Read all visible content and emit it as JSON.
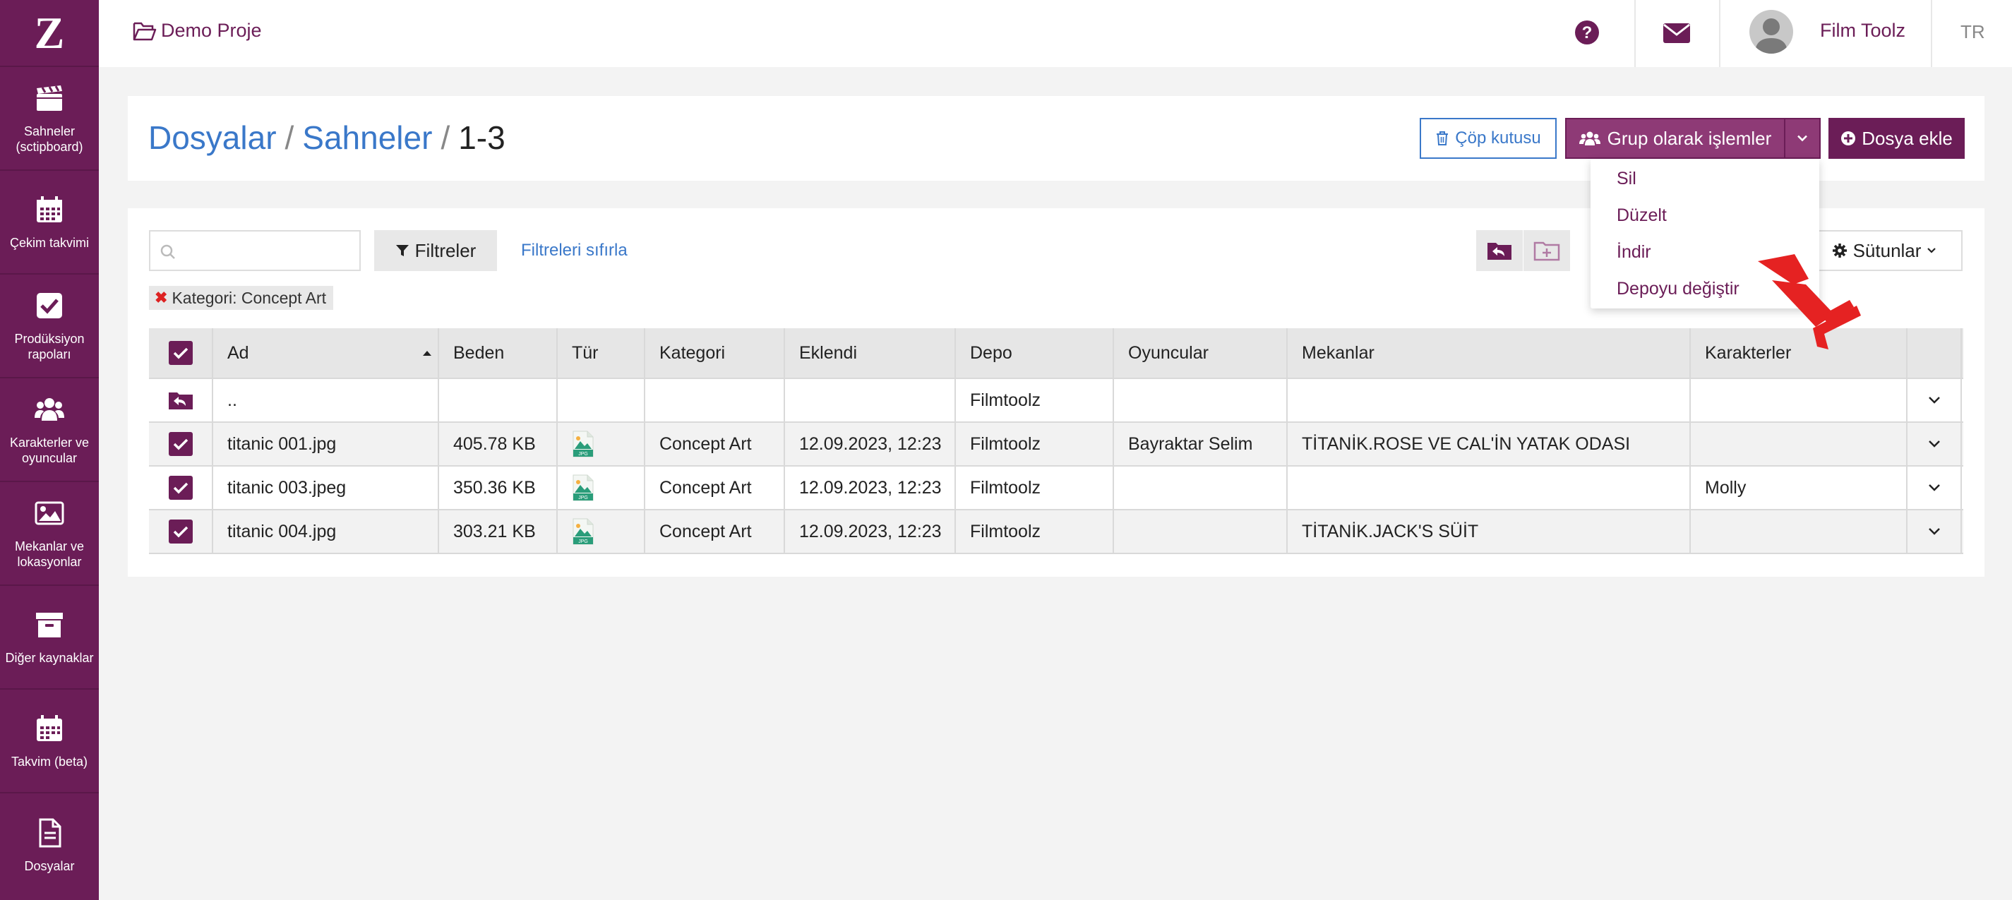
{
  "sidebar": {
    "logo": "Z",
    "items": [
      {
        "label": "Sahneler (sctipboard)",
        "icon": "clapperboard-icon"
      },
      {
        "label": "Çekim takvimi",
        "icon": "calendar-icon"
      },
      {
        "label": "Prodüksiyon rapoları",
        "icon": "check-square-icon"
      },
      {
        "label": "Karakterler ve oyuncular",
        "icon": "users-icon"
      },
      {
        "label": "Mekanlar ve lokasyonlar",
        "icon": "image-icon"
      },
      {
        "label": "Diğer kaynaklar",
        "icon": "archive-icon"
      },
      {
        "label": "Takvim (beta)",
        "icon": "calendar-icon"
      },
      {
        "label": "Dosyalar",
        "icon": "file-icon"
      }
    ]
  },
  "topbar": {
    "project": "Demo Proje",
    "username": "Film Toolz",
    "language": "TR"
  },
  "header": {
    "breadcrumb": [
      "Dosyalar",
      "Sahneler",
      "1-3"
    ],
    "trash_label": "Çöp kutusu",
    "group_label": "Grup olarak işlemler",
    "add_label": "Dosya ekle"
  },
  "group_menu": [
    "Sil",
    "Düzelt",
    "İndir",
    "Depoyu değiştir"
  ],
  "toolbar": {
    "search_placeholder": "",
    "filter_label": "Filtreler",
    "reset_label": "Filtreleri sıfırla",
    "columns_label": "Sütunlar"
  },
  "active_filter": {
    "key": "Kategori:",
    "value": "Concept Art"
  },
  "table": {
    "columns": [
      "Ad",
      "Beden",
      "Tür",
      "Kategori",
      "Eklendi",
      "Depo",
      "Oyuncular",
      "Mekanlar",
      "Karakterler"
    ],
    "parent_row": {
      "name": "..",
      "depo": "Filmtoolz"
    },
    "rows": [
      {
        "name": "titanic 001.jpg",
        "size": "405.78 KB",
        "type": "JPG",
        "category": "Concept Art",
        "added": "12.09.2023, 12:23",
        "depo": "Filmtoolz",
        "actors": "Bayraktar Selim",
        "locations": "TİTANİK.ROSE VE CAL'İN YATAK ODASI",
        "characters": "",
        "checked": true
      },
      {
        "name": "titanic 003.jpeg",
        "size": "350.36 KB",
        "type": "JPG",
        "category": "Concept Art",
        "added": "12.09.2023, 12:23",
        "depo": "Filmtoolz",
        "actors": "",
        "locations": "",
        "characters": "Molly",
        "checked": true
      },
      {
        "name": "titanic 004.jpg",
        "size": "303.21 KB",
        "type": "JPG",
        "category": "Concept Art",
        "added": "12.09.2023, 12:23",
        "depo": "Filmtoolz",
        "actors": "",
        "locations": "TİTANİK.JACK'S SÜİT",
        "characters": "",
        "checked": true
      }
    ]
  },
  "colors": {
    "brand": "#6b1d57",
    "group_button": "#8e3a76",
    "link": "#3a78c9",
    "annotation_arrow": "#e52222"
  }
}
